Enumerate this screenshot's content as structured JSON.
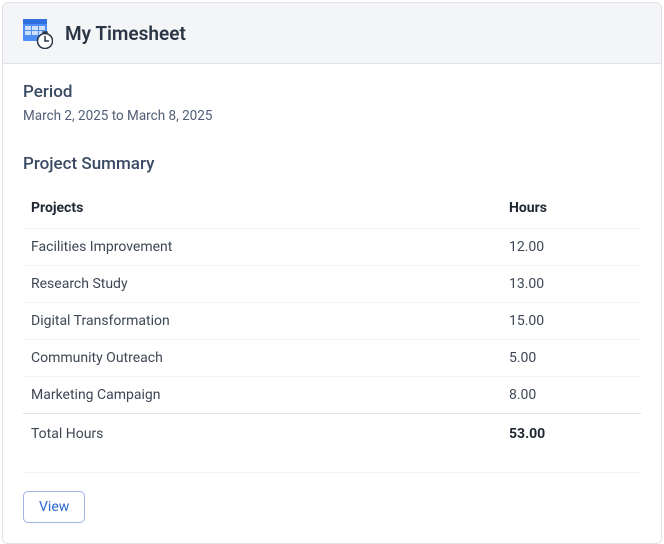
{
  "header": {
    "title": "My Timesheet"
  },
  "period": {
    "label": "Period",
    "text": "March 2, 2025 to March 8, 2025"
  },
  "summary": {
    "title": "Project Summary",
    "columns": {
      "projects": "Projects",
      "hours": "Hours"
    },
    "rows": [
      {
        "project": "Facilities Improvement",
        "hours": "12.00"
      },
      {
        "project": "Research Study",
        "hours": "13.00"
      },
      {
        "project": "Digital Transformation",
        "hours": "15.00"
      },
      {
        "project": "Community Outreach",
        "hours": "5.00"
      },
      {
        "project": "Marketing Campaign",
        "hours": "8.00"
      }
    ],
    "total": {
      "label": "Total Hours",
      "hours": "53.00"
    }
  },
  "actions": {
    "view": "View"
  }
}
